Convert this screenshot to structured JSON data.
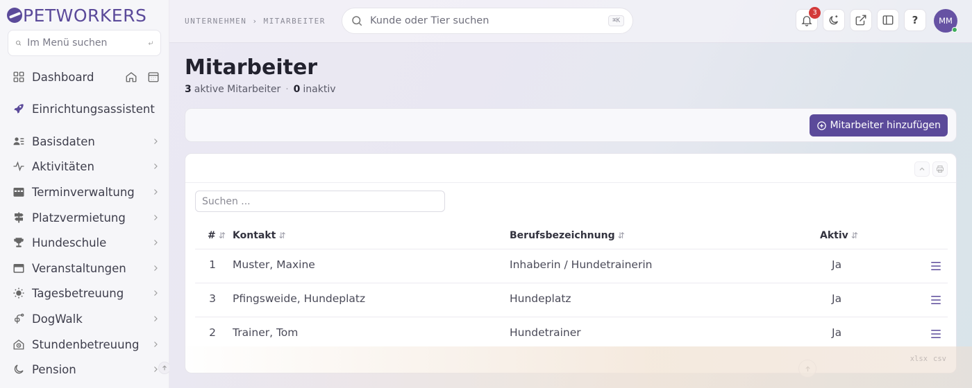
{
  "brand": {
    "name": "PETWORKERS",
    "color": "#5b4a9a"
  },
  "menu_search": {
    "placeholder": "Im Menü suchen"
  },
  "nav": {
    "items": [
      {
        "label": "Dashboard",
        "icon": "dashboard-icon"
      },
      {
        "label": "Einrichtungsassistent",
        "icon": "rocket-icon"
      },
      {
        "label": "Basisdaten",
        "icon": "contacts-icon"
      },
      {
        "label": "Aktivitäten",
        "icon": "activity-icon"
      },
      {
        "label": "Terminverwaltung",
        "icon": "calendar-icon"
      },
      {
        "label": "Platzvermietung",
        "icon": "signpost-icon"
      },
      {
        "label": "Hundeschule",
        "icon": "trophy-icon"
      },
      {
        "label": "Veranstaltungen",
        "icon": "event-icon"
      },
      {
        "label": "Tagesbetreuung",
        "icon": "sun-icon"
      },
      {
        "label": "DogWalk",
        "icon": "leash-icon"
      },
      {
        "label": "Stundenbetreuung",
        "icon": "clock-house-icon"
      },
      {
        "label": "Pension",
        "icon": "moon-icon"
      }
    ]
  },
  "breadcrumb": {
    "first": "UNTERNEHMEN",
    "sep": "›",
    "second": "MITARBEITER"
  },
  "top_search": {
    "placeholder": "Kunde oder Tier suchen",
    "shortcut": "⌘K"
  },
  "notifications": {
    "count": "3"
  },
  "user": {
    "initials": "MM",
    "help": "?"
  },
  "page": {
    "title": "Mitarbeiter",
    "active_count": "3",
    "active_label": "aktive Mitarbeiter",
    "separator": "·",
    "inactive_count": "0",
    "inactive_label": "inaktiv"
  },
  "actions": {
    "add_label": "Mitarbeiter hinzufügen"
  },
  "table": {
    "search_placeholder": "Suchen ...",
    "headers": {
      "num": "#",
      "contact": "Kontakt",
      "job": "Berufsbezeichnung",
      "active": "Aktiv"
    },
    "sort_glyph": "⇵",
    "rows": [
      {
        "num": "1",
        "contact": "Muster, Maxine",
        "job": "Inhaberin / Hundetrainerin",
        "active": "Ja"
      },
      {
        "num": "3",
        "contact": "Pfingsweide, Hundeplatz",
        "job": "Hundeplatz",
        "active": "Ja"
      },
      {
        "num": "2",
        "contact": "Trainer, Tom",
        "job": "Hundetrainer",
        "active": "Ja"
      }
    ],
    "exports": [
      "xlsx",
      "csv"
    ]
  }
}
